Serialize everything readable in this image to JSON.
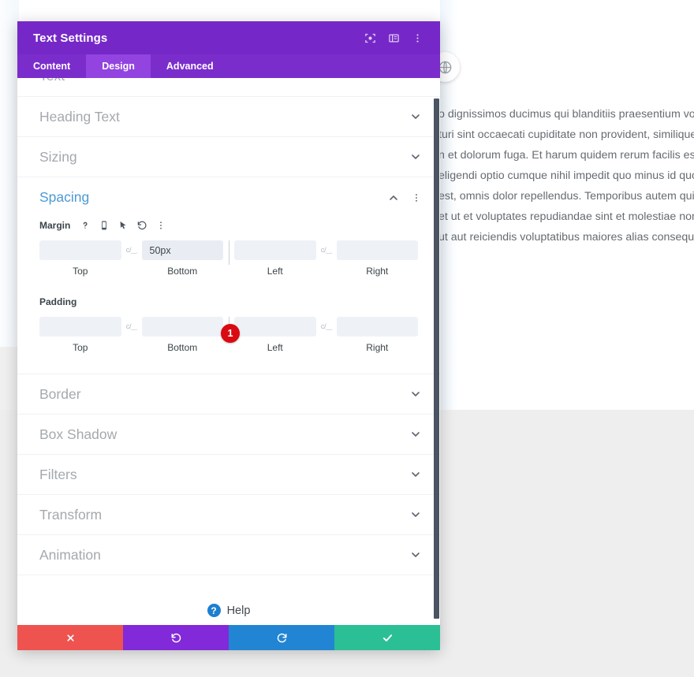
{
  "background": {
    "paragraph_lines": [
      "o dignissimos ducimus qui blanditiis praesentium voluptatu",
      "turi sint occaecati cupiditate non provident, similique sunt i",
      "n et dolorum fuga. Et harum quidem rerum facilis est et exp",
      "eligendi optio cumque nihil impedit quo minus id quod max",
      "est, omnis dolor repellendus. Temporibus autem quibusda",
      "et ut et voluptates repudiandae sint et molestiae non recusa",
      "ut aut reiciendis voluptatibus maiores alias consequatur a"
    ],
    "globe_icon": "globe-icon"
  },
  "modal": {
    "title": "Text Settings",
    "header_icons": [
      {
        "name": "focus-target-icon",
        "glyph": "focus"
      },
      {
        "name": "layout-toggle-icon",
        "glyph": "layout"
      },
      {
        "name": "more-options-icon",
        "glyph": "kebab"
      }
    ],
    "tabs": [
      {
        "label": "Content",
        "active": false
      },
      {
        "label": "Design",
        "active": true
      },
      {
        "label": "Advanced",
        "active": false
      }
    ],
    "sections_above": [
      {
        "label": "Text",
        "expanded": false,
        "clipped": true
      },
      {
        "label": "Heading Text",
        "expanded": false
      },
      {
        "label": "Sizing",
        "expanded": false
      }
    ],
    "spacing": {
      "label": "Spacing",
      "expanded": true,
      "groups": [
        {
          "label": "Margin",
          "icons": [
            {
              "name": "help-icon",
              "glyph": "?"
            },
            {
              "name": "responsive-mobile-icon",
              "glyph": "phone"
            },
            {
              "name": "hover-cursor-icon",
              "glyph": "cursor"
            },
            {
              "name": "reset-icon",
              "glyph": "undo"
            },
            {
              "name": "more-options-icon",
              "glyph": "kebab"
            }
          ],
          "fields": [
            {
              "caption": "Top",
              "value": ""
            },
            {
              "caption": "Bottom",
              "value": "50px"
            },
            {
              "caption": "Left",
              "value": ""
            },
            {
              "caption": "Right",
              "value": ""
            }
          ],
          "link_icon": "link-values-icon"
        },
        {
          "label": "Padding",
          "icons": [],
          "fields": [
            {
              "caption": "Top",
              "value": ""
            },
            {
              "caption": "Bottom",
              "value": ""
            },
            {
              "caption": "Left",
              "value": ""
            },
            {
              "caption": "Right",
              "value": ""
            }
          ],
          "link_icon": "link-values-icon"
        }
      ]
    },
    "sections_below": [
      {
        "label": "Border",
        "expanded": false
      },
      {
        "label": "Box Shadow",
        "expanded": false
      },
      {
        "label": "Filters",
        "expanded": false
      },
      {
        "label": "Transform",
        "expanded": false
      },
      {
        "label": "Animation",
        "expanded": false
      }
    ],
    "help": {
      "label": "Help",
      "glyph": "?"
    },
    "footer": [
      {
        "name": "cancel-button",
        "glyph": "✖"
      },
      {
        "name": "undo-button",
        "glyph": "↺"
      },
      {
        "name": "redo-button",
        "glyph": "↻"
      },
      {
        "name": "save-button",
        "glyph": "✔"
      }
    ]
  },
  "annotation": {
    "step_badge": "1"
  },
  "colors": {
    "header_purple": "#7528c7",
    "tab_purple": "#7b2dcc",
    "tab_active_purple": "#9243e0",
    "accent_blue": "#4c9ad4",
    "badge_red": "#d90a12",
    "cancel_red": "#ef5350",
    "undo_purple": "#8229d9",
    "redo_blue": "#2285d3",
    "save_teal": "#2bbf95"
  }
}
